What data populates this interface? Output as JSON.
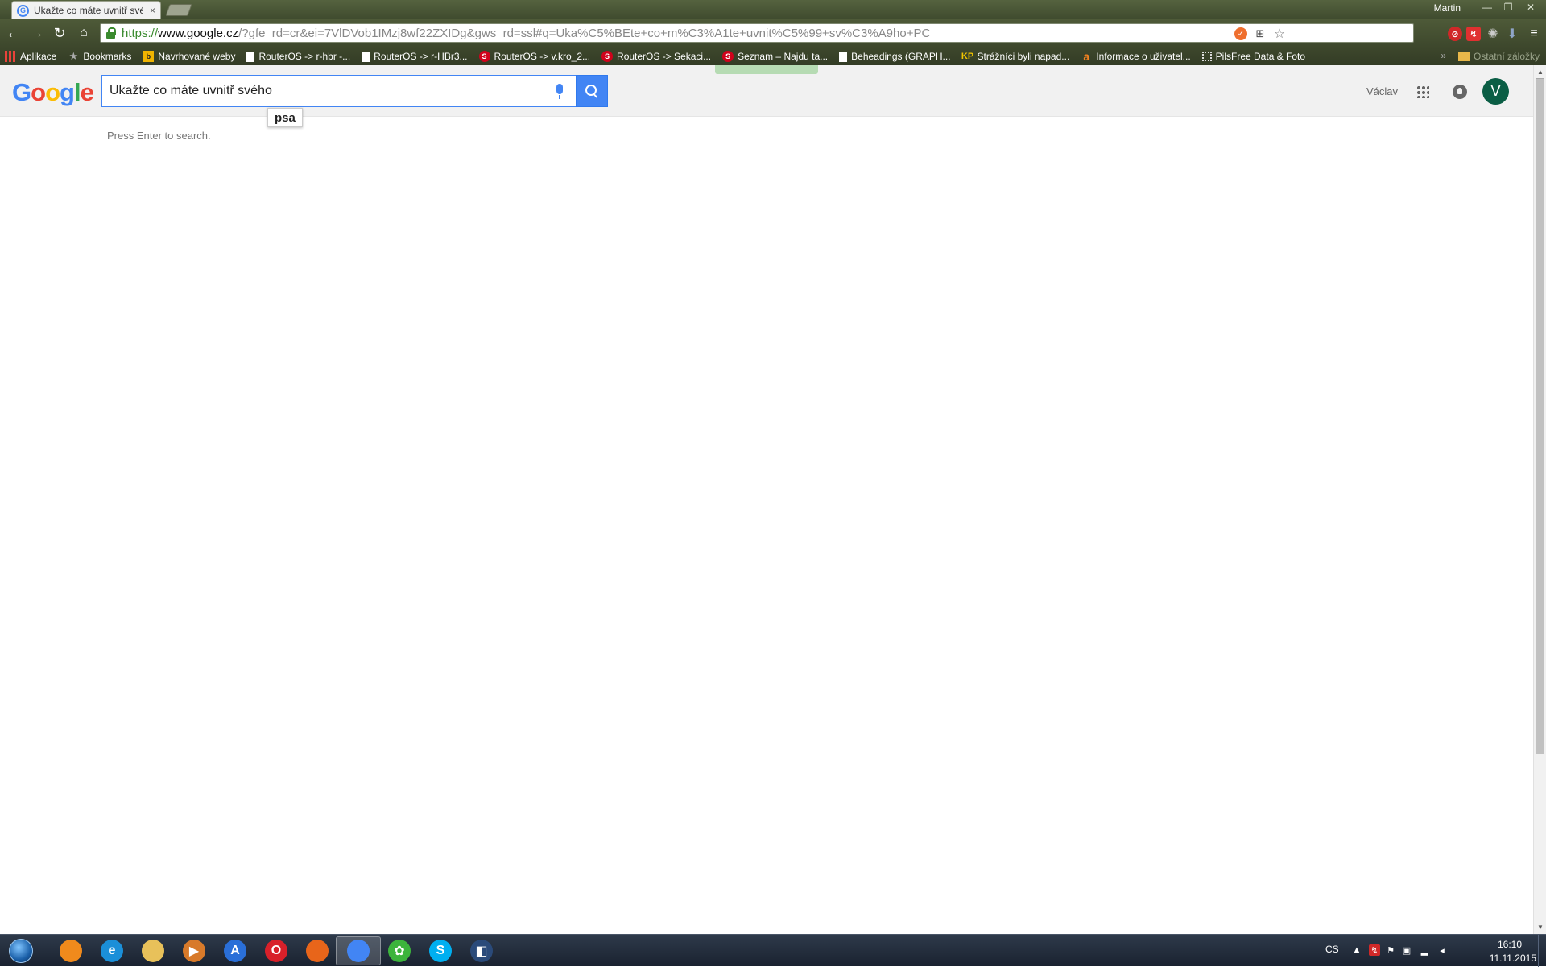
{
  "browser": {
    "tab_title": "Ukažte co máte uvnitř své",
    "tab_close": "×",
    "profile_name": "Martin",
    "url_scheme": "https://",
    "url_host": "www.google.cz",
    "url_rest": "/?gfe_rd=cr&ei=7VlDVob1IMzj8wf22ZXIDg&gws_rd=ssl#q=Uka%C5%BEte+co+m%C3%A1te+uvnit%C5%99+sv%C3%A9ho+PC",
    "window_controls": {
      "minimize": "—",
      "maximize": "❐",
      "close": "✕"
    }
  },
  "bookmarks": [
    {
      "label": "Aplikace",
      "icon": "apps-icon"
    },
    {
      "label": "Bookmarks",
      "icon": "star-icon"
    },
    {
      "label": "Navrhované weby",
      "icon": "bing-icon"
    },
    {
      "label": "RouterOS -> r-hbr -...",
      "icon": "page-icon"
    },
    {
      "label": "RouterOS -> r-HBr3...",
      "icon": "page-icon"
    },
    {
      "label": "RouterOS -> v.kro_2...",
      "icon": "seznam-icon"
    },
    {
      "label": "RouterOS -> Sekaci...",
      "icon": "seznam-icon"
    },
    {
      "label": "Seznam – Najdu ta...",
      "icon": "seznam-icon"
    },
    {
      "label": "Beheadings (GRAPH...",
      "icon": "page-icon"
    },
    {
      "label": "Strážníci byli napad...",
      "icon": "kp-icon"
    },
    {
      "label": "Informace o uživatel...",
      "icon": "amazon-icon"
    },
    {
      "label": "PilsFree Data & Foto",
      "icon": "frame-icon"
    }
  ],
  "bookmarks_overflow": "»",
  "bookmarks_other": "Ostatní záložky",
  "google": {
    "search_value": "Ukažte co máte uvnitř svého",
    "suggestion": "psa",
    "hint": "Press Enter to search.",
    "user_name": "Václav",
    "avatar_letter": "V"
  },
  "taskbar": {
    "apps": [
      {
        "name": "firefox-like-orange",
        "label": "",
        "color": "#f08a1c"
      },
      {
        "name": "internet-explorer",
        "label": "e",
        "color": "#1b8fd8"
      },
      {
        "name": "file-explorer",
        "label": "",
        "color": "#e8c15a"
      },
      {
        "name": "media-player",
        "label": "▶",
        "color": "#d87a2a"
      },
      {
        "name": "navigator",
        "label": "A",
        "color": "#2a6fd8"
      },
      {
        "name": "opera",
        "label": "O",
        "color": "#d8202a"
      },
      {
        "name": "firefox",
        "label": "",
        "color": "#e8651a"
      },
      {
        "name": "chrome",
        "label": "",
        "color": "#4285f4",
        "active": true
      },
      {
        "name": "icq",
        "label": "✿",
        "color": "#3cb43c"
      },
      {
        "name": "skype",
        "label": "S",
        "color": "#00aff0"
      },
      {
        "name": "dolby",
        "label": "◧",
        "color": "#2a4a7a"
      }
    ],
    "lang": "CS",
    "time": "16:10",
    "date": "11.11.2015"
  },
  "colors": {
    "accent": "#4285f4",
    "avatar": "#0b5e45",
    "url_secure": "#3a8a2e"
  }
}
